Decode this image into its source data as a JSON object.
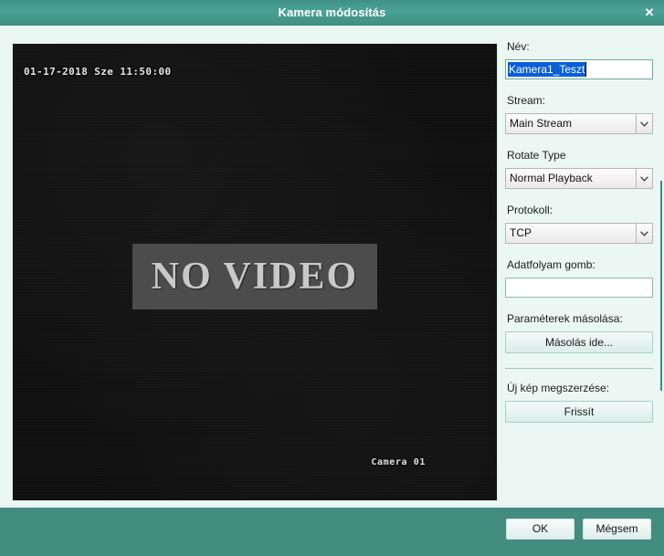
{
  "window": {
    "title": "Kamera módosítás",
    "close_label": "✕"
  },
  "preview": {
    "timestamp": "01-17-2018 Sze 11:50:00",
    "no_video_text": "NO VIDEO",
    "camera_label": "Camera 01"
  },
  "form": {
    "name": {
      "label": "Név:",
      "value": "Kamera1_Teszt",
      "selected": true
    },
    "stream": {
      "label": "Stream:",
      "value": "Main Stream"
    },
    "rotate_type": {
      "label": "Rotate Type",
      "value": "Normal Playback"
    },
    "protocol": {
      "label": "Protokoll:",
      "value": "TCP"
    },
    "stream_button": {
      "label": "Adatfolyam gomb:",
      "value": "",
      "placeholder": ""
    },
    "copy_params": {
      "label": "Paraméterek másolása:",
      "button_label": "Másolás ide..."
    },
    "new_image": {
      "label": "Új kép megszerzése:",
      "button_label": "Frissít"
    }
  },
  "footer": {
    "ok_label": "OK",
    "cancel_label": "Mégsem"
  },
  "colors": {
    "titlebar": "#45998c",
    "footer": "#438c80",
    "dialog_bg": "#eaf7f3",
    "selection": "#0a5fd8",
    "video_bg": "#0d0d0d"
  }
}
